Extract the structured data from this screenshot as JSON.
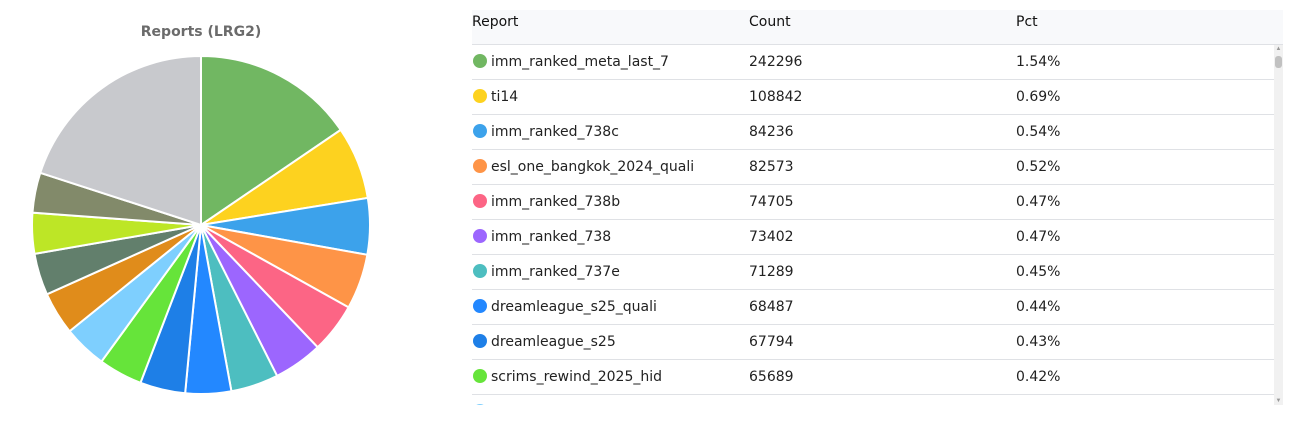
{
  "chart_data": {
    "type": "pie",
    "title": "Reports (LRG2)",
    "slices": [
      {
        "label": "imm_ranked_meta_last_7",
        "value": 242296,
        "pct": "1.54%",
        "color": "#71b762"
      },
      {
        "label": "ti14",
        "value": 108842,
        "pct": "0.69%",
        "color": "#fdd21f"
      },
      {
        "label": "imm_ranked_738c",
        "value": 84236,
        "pct": "0.54%",
        "color": "#3ca2eb"
      },
      {
        "label": "esl_one_bangkok_2024_quali",
        "value": 82573,
        "pct": "0.52%",
        "color": "#fe9447"
      },
      {
        "label": "imm_ranked_738b",
        "value": 74705,
        "pct": "0.47%",
        "color": "#fc6585"
      },
      {
        "label": "imm_ranked_738",
        "value": 73402,
        "pct": "0.47%",
        "color": "#9c66fe"
      },
      {
        "label": "imm_ranked_737e",
        "value": 71289,
        "pct": "0.45%",
        "color": "#4dbec0"
      },
      {
        "label": "dreamleague_s25_quali",
        "value": 68487,
        "pct": "0.44%",
        "color": "#2388ff"
      },
      {
        "label": "dreamleague_s25",
        "value": 67794,
        "pct": "0.43%",
        "color": "#1e7fe7"
      },
      {
        "label": "scrims_rewind_2025_hid",
        "value": 65689,
        "pct": "0.42%",
        "color": "#66e43a"
      },
      {
        "label": "",
        "value": 65000,
        "color": "#7ecffe"
      },
      {
        "label": "",
        "value": 64000,
        "color": "#e08c1b"
      },
      {
        "label": "",
        "value": 62500,
        "color": "#627f6c"
      },
      {
        "label": "",
        "value": 61000,
        "color": "#bde626"
      },
      {
        "label": "",
        "value": 60000,
        "color": "#828a6a"
      },
      {
        "label": "",
        "value": 313000,
        "color": "#c8c9cd"
      }
    ]
  },
  "table": {
    "headers": {
      "report": "Report",
      "count": "Count",
      "pct": "Pct"
    },
    "rows": [
      {
        "name": "imm_ranked_meta_last_7",
        "count": "242296",
        "pct": "1.54%",
        "color": "#71b762"
      },
      {
        "name": "ti14",
        "count": "108842",
        "pct": "0.69%",
        "color": "#fdd21f"
      },
      {
        "name": "imm_ranked_738c",
        "count": "84236",
        "pct": "0.54%",
        "color": "#3ca2eb"
      },
      {
        "name": "esl_one_bangkok_2024_quali",
        "count": "82573",
        "pct": "0.52%",
        "color": "#fe9447"
      },
      {
        "name": "imm_ranked_738b",
        "count": "74705",
        "pct": "0.47%",
        "color": "#fc6585"
      },
      {
        "name": "imm_ranked_738",
        "count": "73402",
        "pct": "0.47%",
        "color": "#9c66fe"
      },
      {
        "name": "imm_ranked_737e",
        "count": "71289",
        "pct": "0.45%",
        "color": "#4dbec0"
      },
      {
        "name": "dreamleague_s25_quali",
        "count": "68487",
        "pct": "0.44%",
        "color": "#2388ff"
      },
      {
        "name": "dreamleague_s25",
        "count": "67794",
        "pct": "0.43%",
        "color": "#1e7fe7"
      },
      {
        "name": "scrims_rewind_2025_hid",
        "count": "65689",
        "pct": "0.42%",
        "color": "#66e43a"
      },
      {
        "name": "",
        "count": "",
        "pct": "",
        "color": "#7ecffe"
      }
    ]
  },
  "scrollbar": {
    "up_icon": "▲",
    "down_icon": "▼"
  }
}
